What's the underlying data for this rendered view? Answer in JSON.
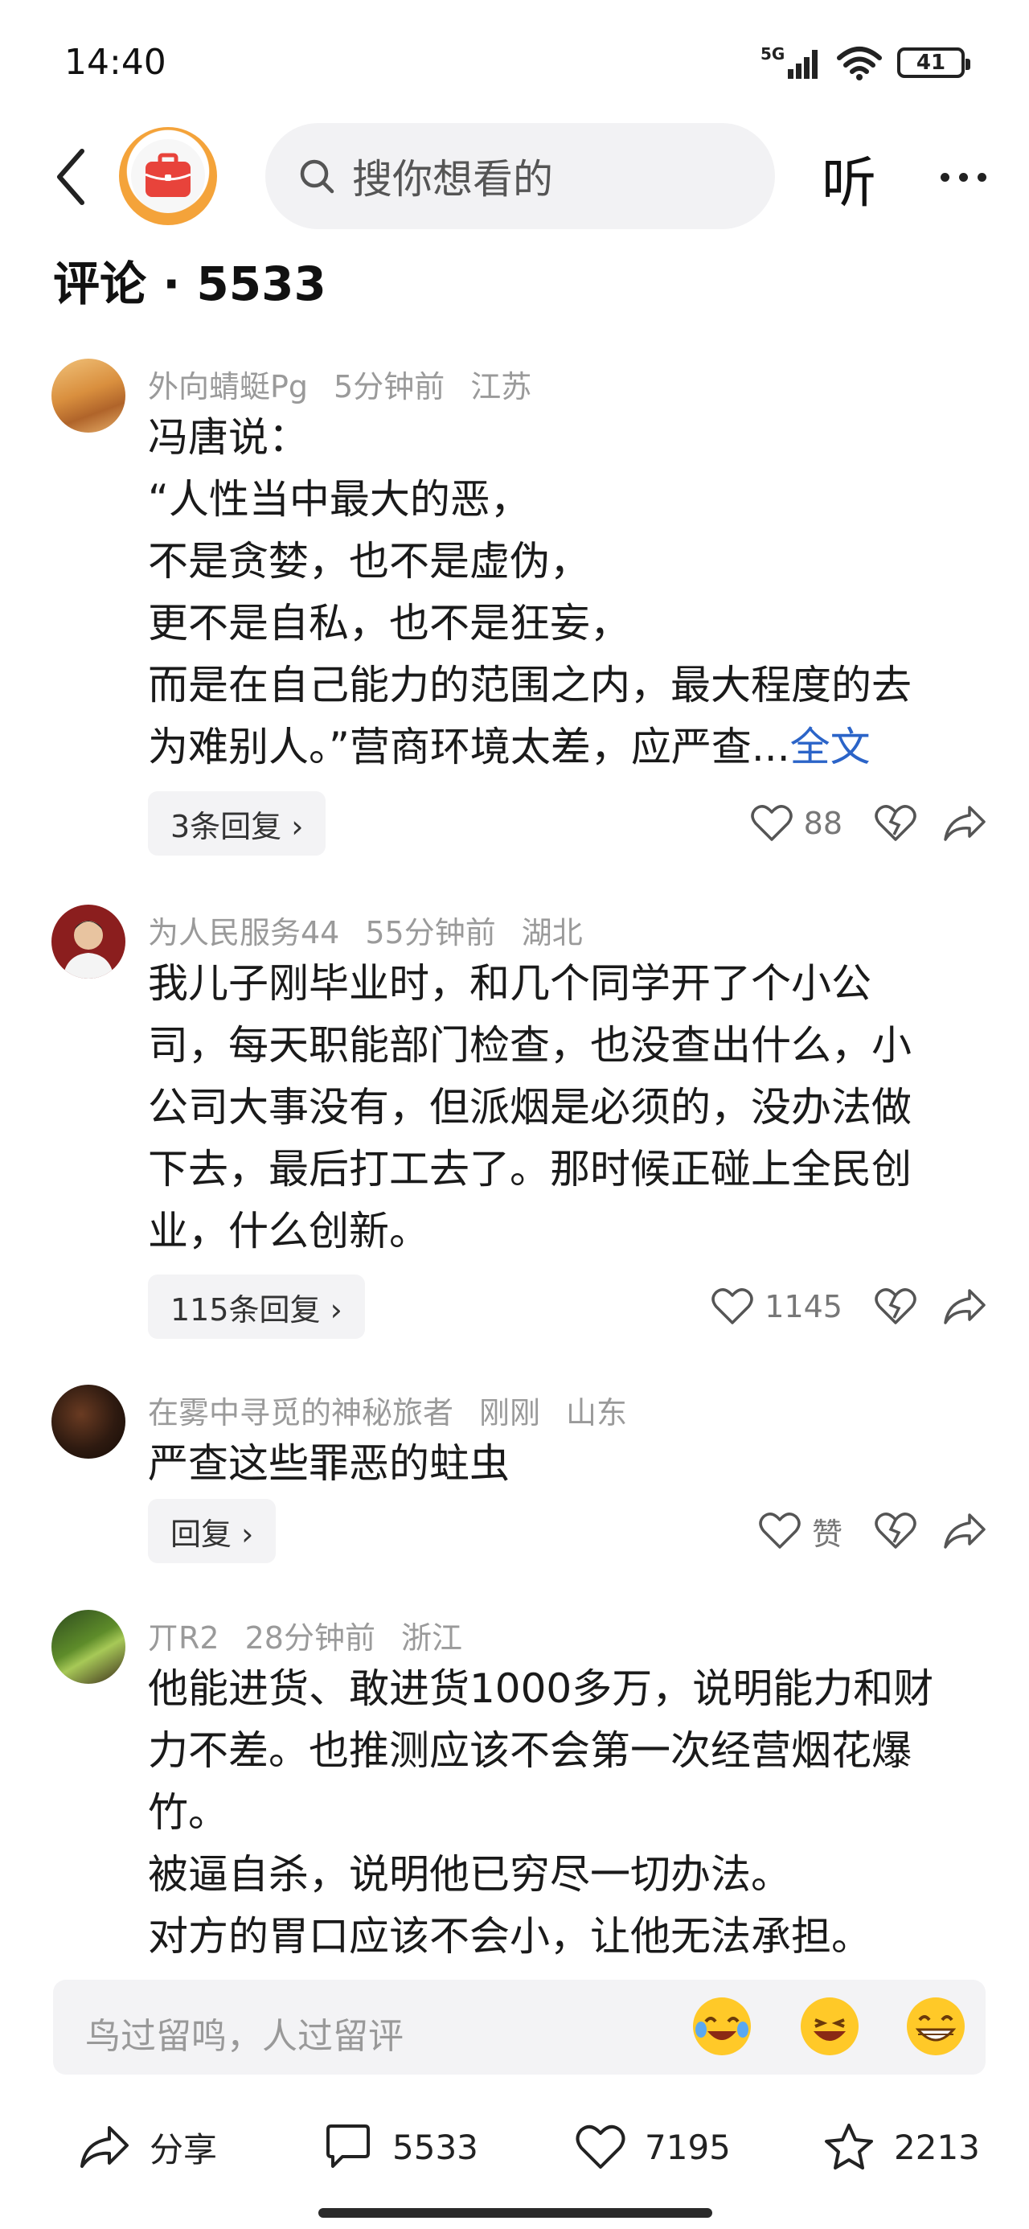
{
  "status_bar": {
    "time": "14:40",
    "network": "5G",
    "battery": "41"
  },
  "nav": {
    "search_placeholder": "搜你想看的",
    "listen_label": "听"
  },
  "comments_header": {
    "title": "评论 · 5533"
  },
  "comments": [
    {
      "user": "外向蜻蜓Pg",
      "time": "5分钟前",
      "region": "江苏",
      "text": "冯唐说：\n“人性当中最大的恶，\n不是贪婪，也不是虚伪，\n更不是自私，也不是狂妄，\n而是在自己能力的范围之内，最大程度的去\n为难别人。”营商环境太差，应严查...",
      "full_label": "全文",
      "reply_label": "3条回复 ›",
      "likes": "88"
    },
    {
      "user": "为人民服务44",
      "time": "55分钟前",
      "region": "湖北",
      "text": "我儿子刚毕业时，和几个同学开了个小公\n司，每天职能部门检查，也没查出什么，小\n公司大事没有，但派烟是必须的，没办法做\n下去，最后打工去了。那时候正碰上全民创\n业，什么创新。",
      "reply_label": "115条回复 ›",
      "likes": "1145"
    },
    {
      "user": "在雾中寻觅的神秘旅者",
      "time": "刚刚",
      "region": "山东",
      "text": "严查这些罪恶的蛀虫",
      "reply_label": "回复 ›",
      "likes": "赞"
    },
    {
      "user": "丌R2",
      "time": "28分钟前",
      "region": "浙江",
      "text": "他能进货、敢进货1000多万，说明能力和财\n力不差。也推测应该不会第一次经营烟花爆\n竹。\n被逼自杀，说明他已穷尽一切办法。\n对方的胃口应该不会小，让他无法承担。"
    }
  ],
  "input_bar": {
    "placeholder": "鸟过留鸣，人过留评"
  },
  "bottom_bar": {
    "share_label": "分享",
    "comments_count": "5533",
    "likes_count": "7195",
    "favorites_count": "2213"
  }
}
